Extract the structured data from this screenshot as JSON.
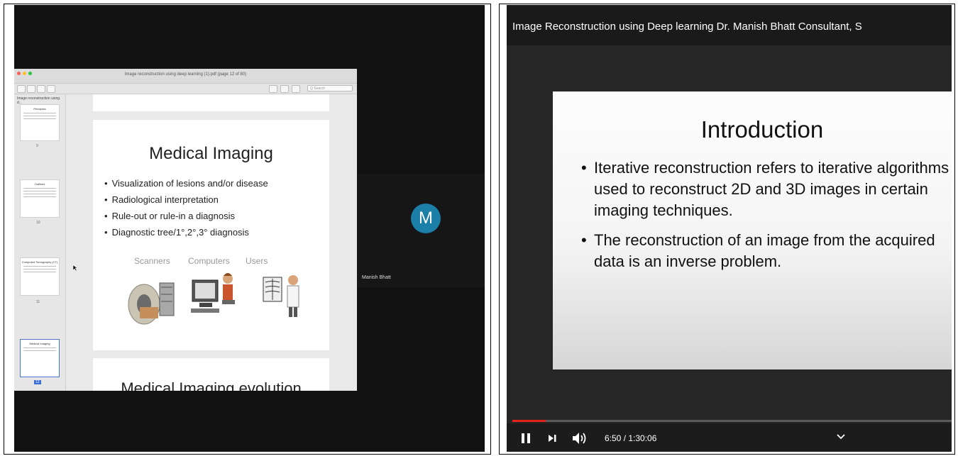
{
  "left": {
    "pdf_window": {
      "title": "Image reconstruction using deep learning (1).pdf (page 12 of 80)",
      "search_placeholder": "Q Search",
      "sidebar_heading": "Image reconstruction using d...",
      "thumbnails": [
        {
          "title": "Principles",
          "page": "9"
        },
        {
          "title": "Outlines",
          "page": "10"
        },
        {
          "title": "Computed Tomography (CT)",
          "page": "11"
        },
        {
          "title": "Medical Imaging",
          "page": "12"
        }
      ]
    },
    "slide": {
      "title": "Medical Imaging",
      "bullets": [
        "Visualization of lesions and/or disease",
        "Radiological interpretation",
        "Rule-out or rule-in a diagnosis",
        "Diagnostic tree/1°,2°,3° diagnosis"
      ],
      "image_labels": [
        "Scanners",
        "Computers",
        "Users"
      ],
      "next_title": "Medical Imaging evolution"
    },
    "participant": {
      "initial": "M",
      "name": "Manish Bhatt",
      "avatar_color": "#1b7fa8"
    }
  },
  "right": {
    "video_title": "Image Reconstruction using Deep learning Dr. Manish Bhatt Consultant, S",
    "slide": {
      "title": "Introduction",
      "bullets": [
        "Iterative reconstruction refers to iterative algorithms used to reconstruct 2D and 3D images in certain imaging techniques.",
        "The reconstruction of an image from the acquired data is an inverse problem."
      ]
    },
    "player": {
      "time": "6:50 / 1:30:06",
      "progress_fraction": 0.076,
      "progress_color": "#e62117"
    }
  }
}
